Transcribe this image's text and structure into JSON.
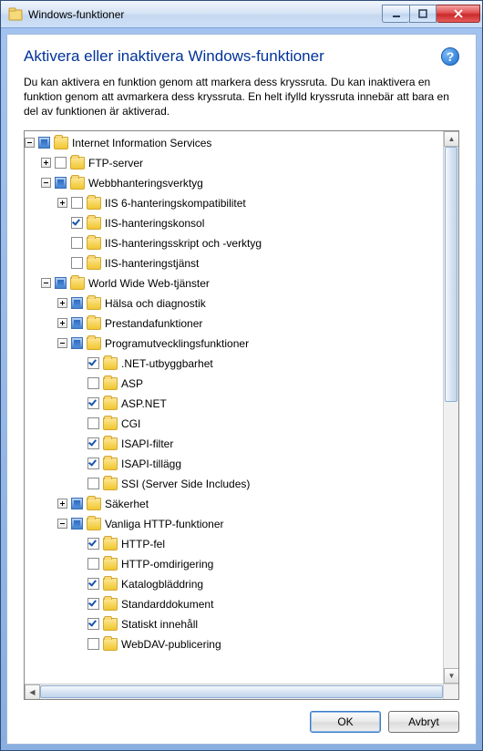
{
  "window": {
    "title": "Windows-funktioner",
    "heading": "Aktivera eller inaktivera Windows-funktioner",
    "description": "Du kan aktivera en funktion genom att markera dess kryssruta. Du kan inaktivera en funktion genom att avmarkera dess kryssruta. En helt ifylld kryssruta innebär att bara en del av funktionen är aktiverad."
  },
  "buttons": {
    "ok": "OK",
    "cancel": "Avbryt"
  },
  "tree": [
    {
      "depth": 0,
      "exp": "minus",
      "check": "partial",
      "label": "Internet Information Services"
    },
    {
      "depth": 1,
      "exp": "plus",
      "check": "empty",
      "label": "FTP-server"
    },
    {
      "depth": 1,
      "exp": "minus",
      "check": "partial",
      "label": "Webbhanteringsverktyg"
    },
    {
      "depth": 2,
      "exp": "plus",
      "check": "empty",
      "label": "IIS 6-hanteringskompatibilitet"
    },
    {
      "depth": 2,
      "exp": "none",
      "check": "checked",
      "label": "IIS-hanteringskonsol"
    },
    {
      "depth": 2,
      "exp": "none",
      "check": "empty",
      "label": "IIS-hanteringsskript och -verktyg"
    },
    {
      "depth": 2,
      "exp": "none",
      "check": "empty",
      "label": "IIS-hanteringstjänst"
    },
    {
      "depth": 1,
      "exp": "minus",
      "check": "partial",
      "label": "World Wide Web-tjänster"
    },
    {
      "depth": 2,
      "exp": "plus",
      "check": "partial",
      "label": "Hälsa och diagnostik"
    },
    {
      "depth": 2,
      "exp": "plus",
      "check": "partial",
      "label": "Prestandafunktioner"
    },
    {
      "depth": 2,
      "exp": "minus",
      "check": "partial",
      "label": "Programutvecklingsfunktioner"
    },
    {
      "depth": 3,
      "exp": "none",
      "check": "checked",
      "label": ".NET-utbyggbarhet"
    },
    {
      "depth": 3,
      "exp": "none",
      "check": "empty",
      "label": "ASP"
    },
    {
      "depth": 3,
      "exp": "none",
      "check": "checked",
      "label": "ASP.NET"
    },
    {
      "depth": 3,
      "exp": "none",
      "check": "empty",
      "label": "CGI"
    },
    {
      "depth": 3,
      "exp": "none",
      "check": "checked",
      "label": "ISAPI-filter"
    },
    {
      "depth": 3,
      "exp": "none",
      "check": "checked",
      "label": "ISAPI-tillägg"
    },
    {
      "depth": 3,
      "exp": "none",
      "check": "empty",
      "label": "SSI (Server Side Includes)"
    },
    {
      "depth": 2,
      "exp": "plus",
      "check": "partial",
      "label": "Säkerhet"
    },
    {
      "depth": 2,
      "exp": "minus",
      "check": "partial",
      "label": "Vanliga HTTP-funktioner"
    },
    {
      "depth": 3,
      "exp": "none",
      "check": "checked",
      "label": "HTTP-fel"
    },
    {
      "depth": 3,
      "exp": "none",
      "check": "empty",
      "label": "HTTP-omdirigering"
    },
    {
      "depth": 3,
      "exp": "none",
      "check": "checked",
      "label": "Katalogbläddring"
    },
    {
      "depth": 3,
      "exp": "none",
      "check": "checked",
      "label": "Standarddokument"
    },
    {
      "depth": 3,
      "exp": "none",
      "check": "checked",
      "label": "Statiskt innehåll"
    },
    {
      "depth": 3,
      "exp": "none",
      "check": "empty",
      "label": "WebDAV-publicering"
    }
  ]
}
